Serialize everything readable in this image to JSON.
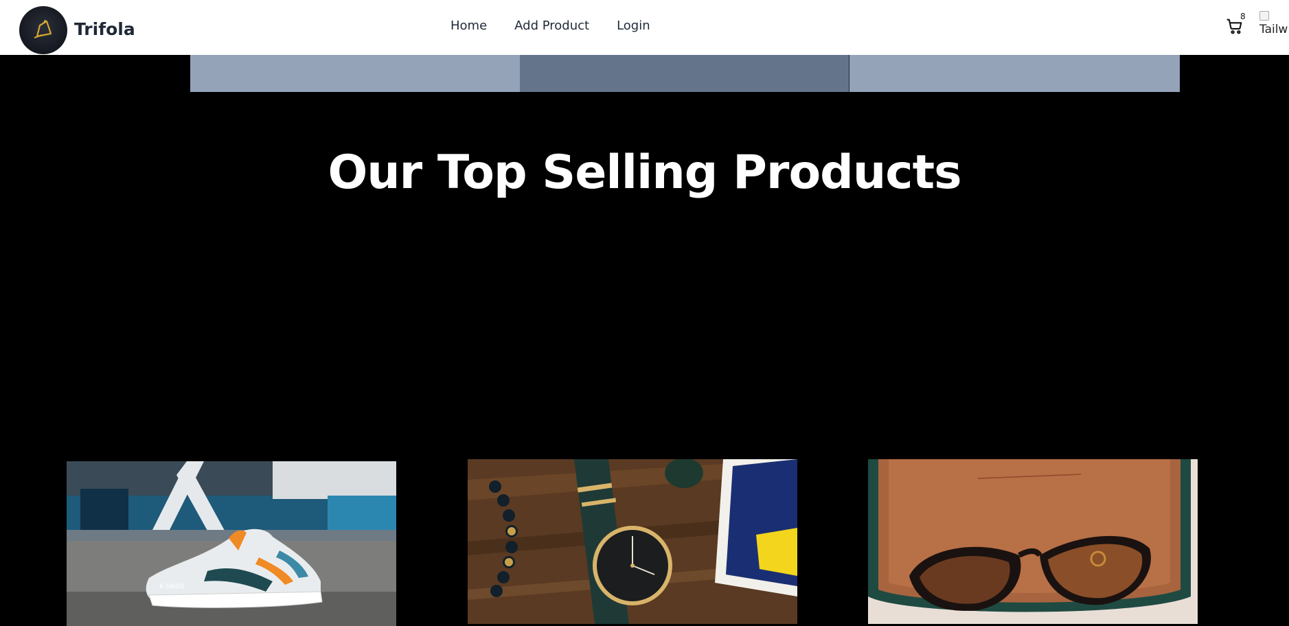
{
  "navbar": {
    "brand": "Trifola",
    "links": [
      {
        "label": "Home"
      },
      {
        "label": "Add Product"
      },
      {
        "label": "Login"
      }
    ],
    "cart_count": "8",
    "avatar_alt": "Tailwind CSS"
  },
  "carousel": {
    "slide_colors": [
      "#94a3b8",
      "#64748b",
      "#94a3b8"
    ]
  },
  "section": {
    "title": "Our Top Selling Products"
  },
  "products": [
    {
      "image": "sneaker-photo"
    },
    {
      "image": "watch-photo"
    },
    {
      "image": "sunglasses-photo"
    }
  ]
}
